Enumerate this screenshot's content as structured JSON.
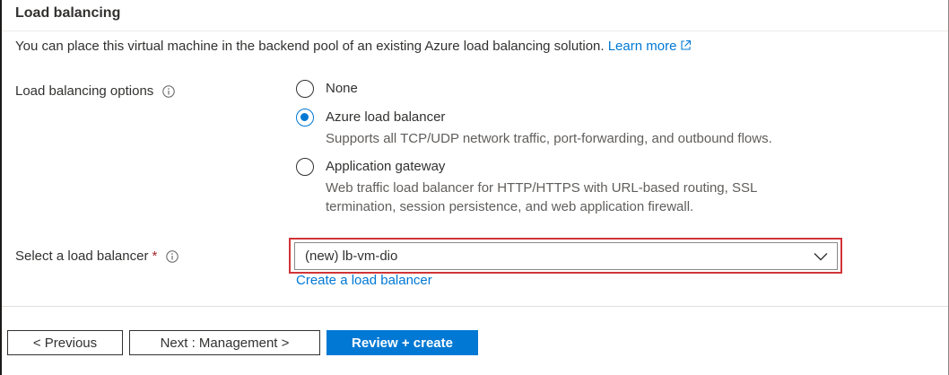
{
  "section": {
    "title": "Load balancing",
    "description": "You can place this virtual machine in the backend pool of an existing Azure load balancing solution.",
    "learn_more": "Learn more"
  },
  "options": {
    "label": "Load balancing options",
    "items": [
      {
        "label": "None",
        "description": "",
        "checked": false
      },
      {
        "label": "Azure load balancer",
        "description": "Supports all TCP/UDP network traffic, port-forwarding, and outbound flows.",
        "checked": true
      },
      {
        "label": "Application gateway",
        "description": "Web traffic load balancer for HTTP/HTTPS with URL-based routing, SSL termination, session persistence, and web application firewall.",
        "checked": false
      }
    ]
  },
  "load_balancer": {
    "label": "Select a load balancer",
    "required_mark": "*",
    "selected": "(new) lb-vm-dio",
    "create_link": "Create a load balancer"
  },
  "footer": {
    "previous": "< Previous",
    "next": "Next : Management >",
    "review": "Review + create"
  },
  "colors": {
    "accent": "#0078d4",
    "highlight": "#d13438"
  },
  "icons": {
    "info": "info-icon",
    "external_link": "external-link-icon",
    "chevron": "chevron-down-icon"
  }
}
